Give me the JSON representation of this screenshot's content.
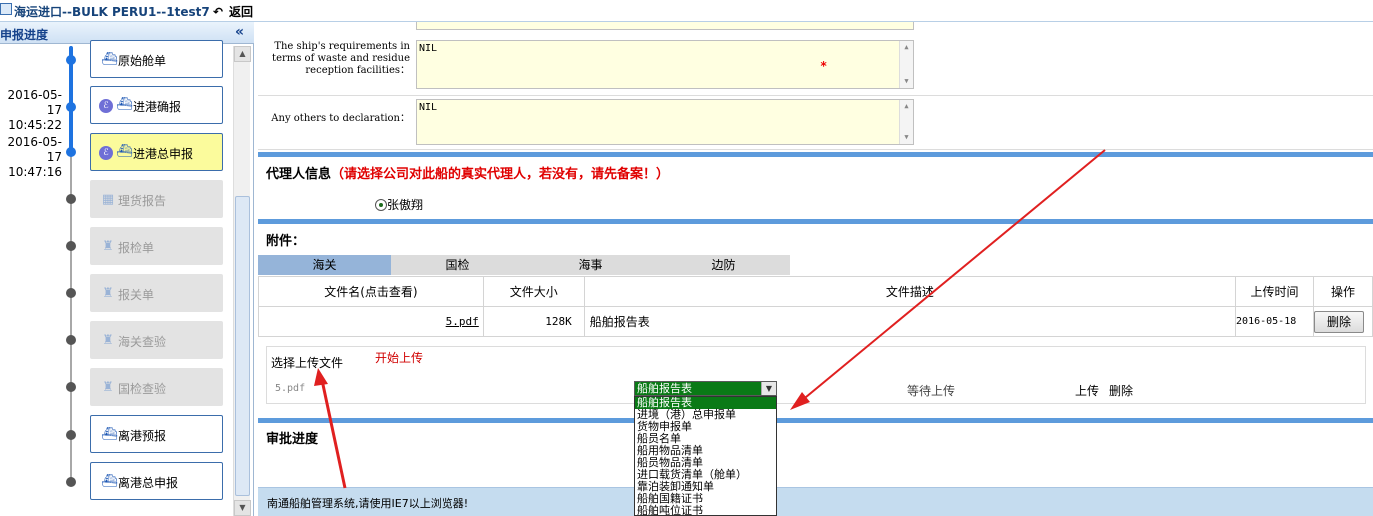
{
  "header": {
    "title": "海运进口--BULK PERU1--1test7",
    "back_label": "返回"
  },
  "sidebar": {
    "title": "申报进度",
    "collapse_glyph": "«",
    "steps": [
      {
        "label": "原始舱单",
        "status": "done",
        "date": "",
        "time": ""
      },
      {
        "label": "进港确报",
        "status": "done",
        "date": "2016-05-17",
        "time": "10:45:22"
      },
      {
        "label": "进港总申报",
        "status": "current",
        "date": "2016-05-17",
        "time": "10:47:16"
      },
      {
        "label": "理货报告",
        "status": "pending"
      },
      {
        "label": "报检单",
        "status": "pending"
      },
      {
        "label": "报关单",
        "status": "pending"
      },
      {
        "label": "海关查验",
        "status": "pending"
      },
      {
        "label": "国检查验",
        "status": "pending"
      },
      {
        "label": "离港预报",
        "status": "done"
      },
      {
        "label": "离港总申报",
        "status": "done"
      }
    ]
  },
  "form": {
    "waste_label": "The ship's requirements in terms of waste and residue reception facilities：",
    "waste_value": "NIL",
    "others_label": "Any others to declaration：",
    "others_value": "NIL",
    "required_mark": "*"
  },
  "agent": {
    "title": "代理人信息",
    "warning": "（请选择公司对此船的真实代理人，若没有，请先备案！）",
    "name": "张傲翔"
  },
  "attachments": {
    "title": "附件：",
    "tabs": [
      "海关",
      "国检",
      "海事",
      "边防"
    ],
    "active_tab": "海关",
    "columns": [
      "文件名(点击查看)",
      "文件大小",
      "文件描述",
      "上传时间",
      "操作"
    ],
    "rows": [
      {
        "name": "5.pdf",
        "size": "128K",
        "desc": "船舶报告表",
        "date": "2016-05-18",
        "action": "删除"
      }
    ]
  },
  "upload": {
    "pick_label": "选择上传文件",
    "start_label": "开始上传",
    "file_name": "5.pdf",
    "status": "等待上传",
    "upload_link": "上传",
    "delete_link": "删除",
    "selected_type": "船舶报告表",
    "options": [
      "船舶报告表",
      "进境（港）总申报单",
      "货物申报单",
      "船员名单",
      "船用物品清单",
      "船员物品清单",
      "进口载货清单（舱单）",
      "靠泊装卸通知单",
      "船舶国籍证书",
      "船舶吨位证书"
    ]
  },
  "review": {
    "title": "审批进度"
  },
  "footer": {
    "text": "南通船舶管理系统,请使用IE7以上浏览器!"
  },
  "colors": {
    "accent": "#5d9bdc",
    "active_timeline": "#1e73e0",
    "current_step": "#fbfb9c",
    "warning": "#e00000",
    "annotation_arrow": "#e02020",
    "dropdown_selected": "#0a7a16"
  }
}
